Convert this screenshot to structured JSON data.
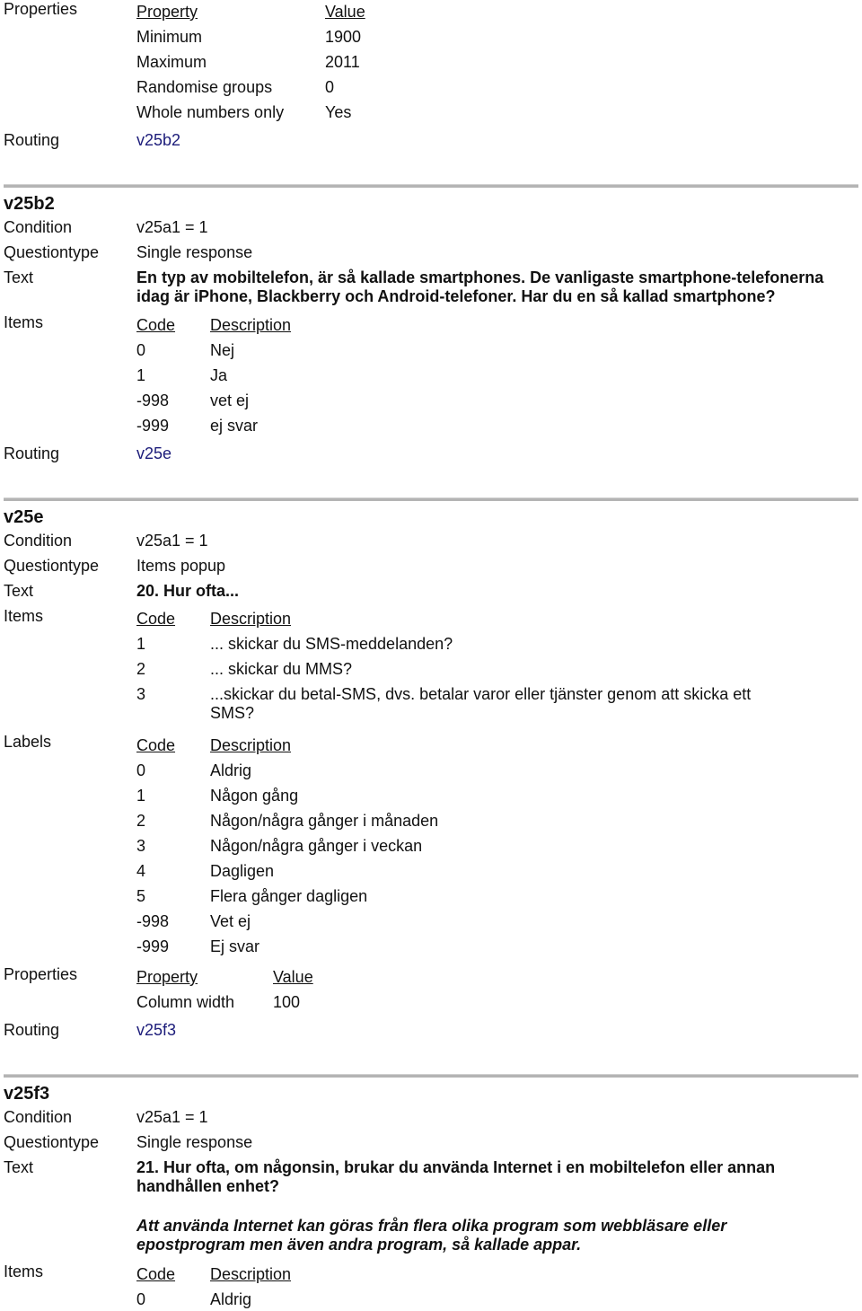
{
  "top_section": {
    "properties_label": "Properties",
    "property_header": "Property",
    "value_header": "Value",
    "properties": [
      {
        "property": "Minimum",
        "value": "1900"
      },
      {
        "property": "Maximum",
        "value": "2011"
      },
      {
        "property": "Randomise groups",
        "value": "0"
      },
      {
        "property": "Whole numbers only",
        "value": "Yes"
      }
    ],
    "routing_label": "Routing",
    "routing": "v25b2"
  },
  "labels": {
    "condition": "Condition",
    "questiontype": "Questiontype",
    "text": "Text",
    "items": "Items",
    "labels": "Labels",
    "properties": "Properties",
    "routing": "Routing",
    "code": "Code",
    "description": "Description",
    "property": "Property",
    "value": "Value"
  },
  "v25b2": {
    "name": "v25b2",
    "condition": "v25a1 = 1",
    "questiontype": "Single response",
    "text_line1": "En typ av mobiltelefon, är så kallade smartphones. De vanligaste smartphone-telefonerna",
    "text_line2": "idag är iPhone, Blackberry och Android-telefoner. Har du en så kallad smartphone?",
    "items": [
      {
        "code": "0",
        "description": "Nej"
      },
      {
        "code": "1",
        "description": "Ja"
      },
      {
        "code": "-998",
        "description": "vet ej"
      },
      {
        "code": "-999",
        "description": "ej svar"
      }
    ],
    "routing": "v25e"
  },
  "v25e": {
    "name": "v25e",
    "condition": "v25a1 = 1",
    "questiontype": "Items popup",
    "text": "20. Hur ofta...",
    "items": [
      {
        "code": "1",
        "description": "... skickar du SMS-meddelanden?"
      },
      {
        "code": "2",
        "description": "... skickar du MMS?"
      },
      {
        "code": "3",
        "description": "...skickar du betal-SMS, dvs. betalar varor eller tjänster genom att skicka ett SMS?"
      }
    ],
    "labels": [
      {
        "code": "0",
        "description": "Aldrig"
      },
      {
        "code": "1",
        "description": "Någon gång"
      },
      {
        "code": "2",
        "description": "Någon/några gånger i månaden"
      },
      {
        "code": "3",
        "description": "Någon/några gånger i veckan"
      },
      {
        "code": "4",
        "description": "Dagligen"
      },
      {
        "code": "5",
        "description": "Flera gånger dagligen"
      },
      {
        "code": "-998",
        "description": "Vet ej"
      },
      {
        "code": "-999",
        "description": "Ej svar"
      }
    ],
    "properties": [
      {
        "property": "Column width",
        "value": "100"
      }
    ],
    "routing": "v25f3"
  },
  "v25f3": {
    "name": "v25f3",
    "condition": "v25a1 = 1",
    "questiontype": "Single response",
    "text_line1": "21. Hur ofta, om någonsin, brukar du använda Internet i en mobiltelefon eller annan",
    "text_line2": "handhållen enhet?",
    "note_line1": "Att använda Internet kan göras från flera olika program som webbläsare eller",
    "note_line2": "epostprogram men även andra program, så kallade appar.",
    "items": [
      {
        "code": "0",
        "description": "Aldrig"
      }
    ]
  }
}
